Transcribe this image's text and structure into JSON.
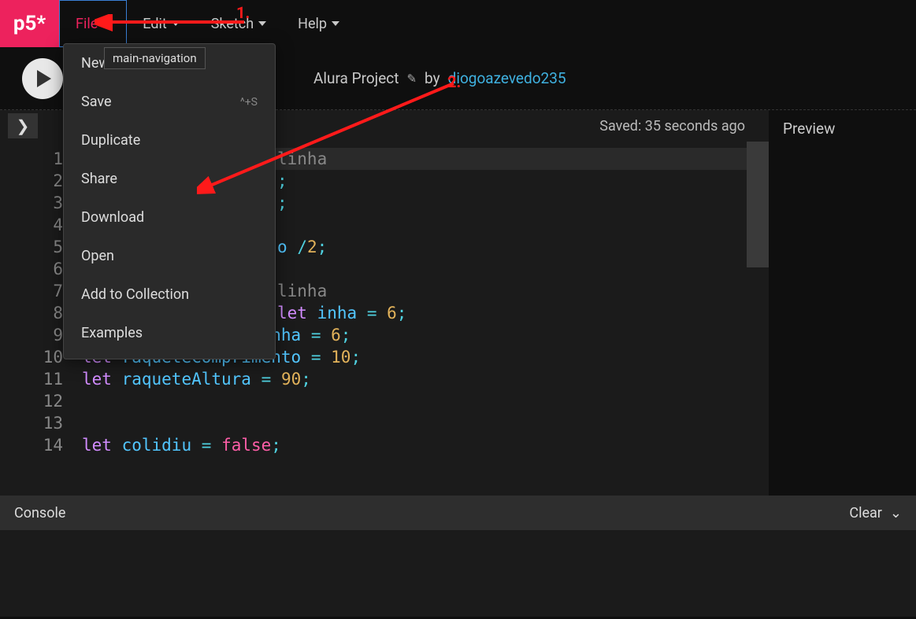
{
  "logo": "p5*",
  "nav": {
    "file": "File",
    "edit": "Edit",
    "sketch": "Sketch",
    "help": "Help"
  },
  "tooltip": "main-navigation",
  "project": {
    "title": "Alura Project",
    "by": "by",
    "author": "diogoazevedo235"
  },
  "saved": "Saved: 35 seconds ago",
  "preview_heading": "Preview",
  "dropdown": {
    "new": "New",
    "save": "Save",
    "save_shortcut": "^+S",
    "duplicate": "Duplicate",
    "share": "Share",
    "download": "Download",
    "open": "Open",
    "add_collection": "Add to Collection",
    "examples": "Examples"
  },
  "console": {
    "label": "Console",
    "clear": "Clear"
  },
  "annotations": {
    "one": "1.",
    "two": "2."
  },
  "code_lines": [
    {
      "n": 1,
      "type": "comment",
      "text": "linha"
    },
    {
      "n": 2,
      "type": "frag",
      "text": ";"
    },
    {
      "n": 3,
      "type": "frag",
      "text": ";"
    },
    {
      "n": 4,
      "type": "blank"
    },
    {
      "n": 5,
      "type": "frag2",
      "text": "o /2;"
    },
    {
      "n": 6,
      "type": "blank"
    },
    {
      "n": 7,
      "type": "comment",
      "text": "linha"
    },
    {
      "n": 8,
      "type": "let",
      "var": "inha",
      "val": "6"
    },
    {
      "n": 9,
      "type": "let",
      "var": "velocidadeYBolinha",
      "val": "6"
    },
    {
      "n": 10,
      "type": "let",
      "var": "raqueteComprimento",
      "val": "10"
    },
    {
      "n": 11,
      "type": "let",
      "var": "raqueteAltura",
      "val": "90"
    },
    {
      "n": 12,
      "type": "blank"
    },
    {
      "n": 13,
      "type": "blank"
    },
    {
      "n": 14,
      "type": "letbool",
      "var": "colidiu",
      "val": "false"
    }
  ]
}
